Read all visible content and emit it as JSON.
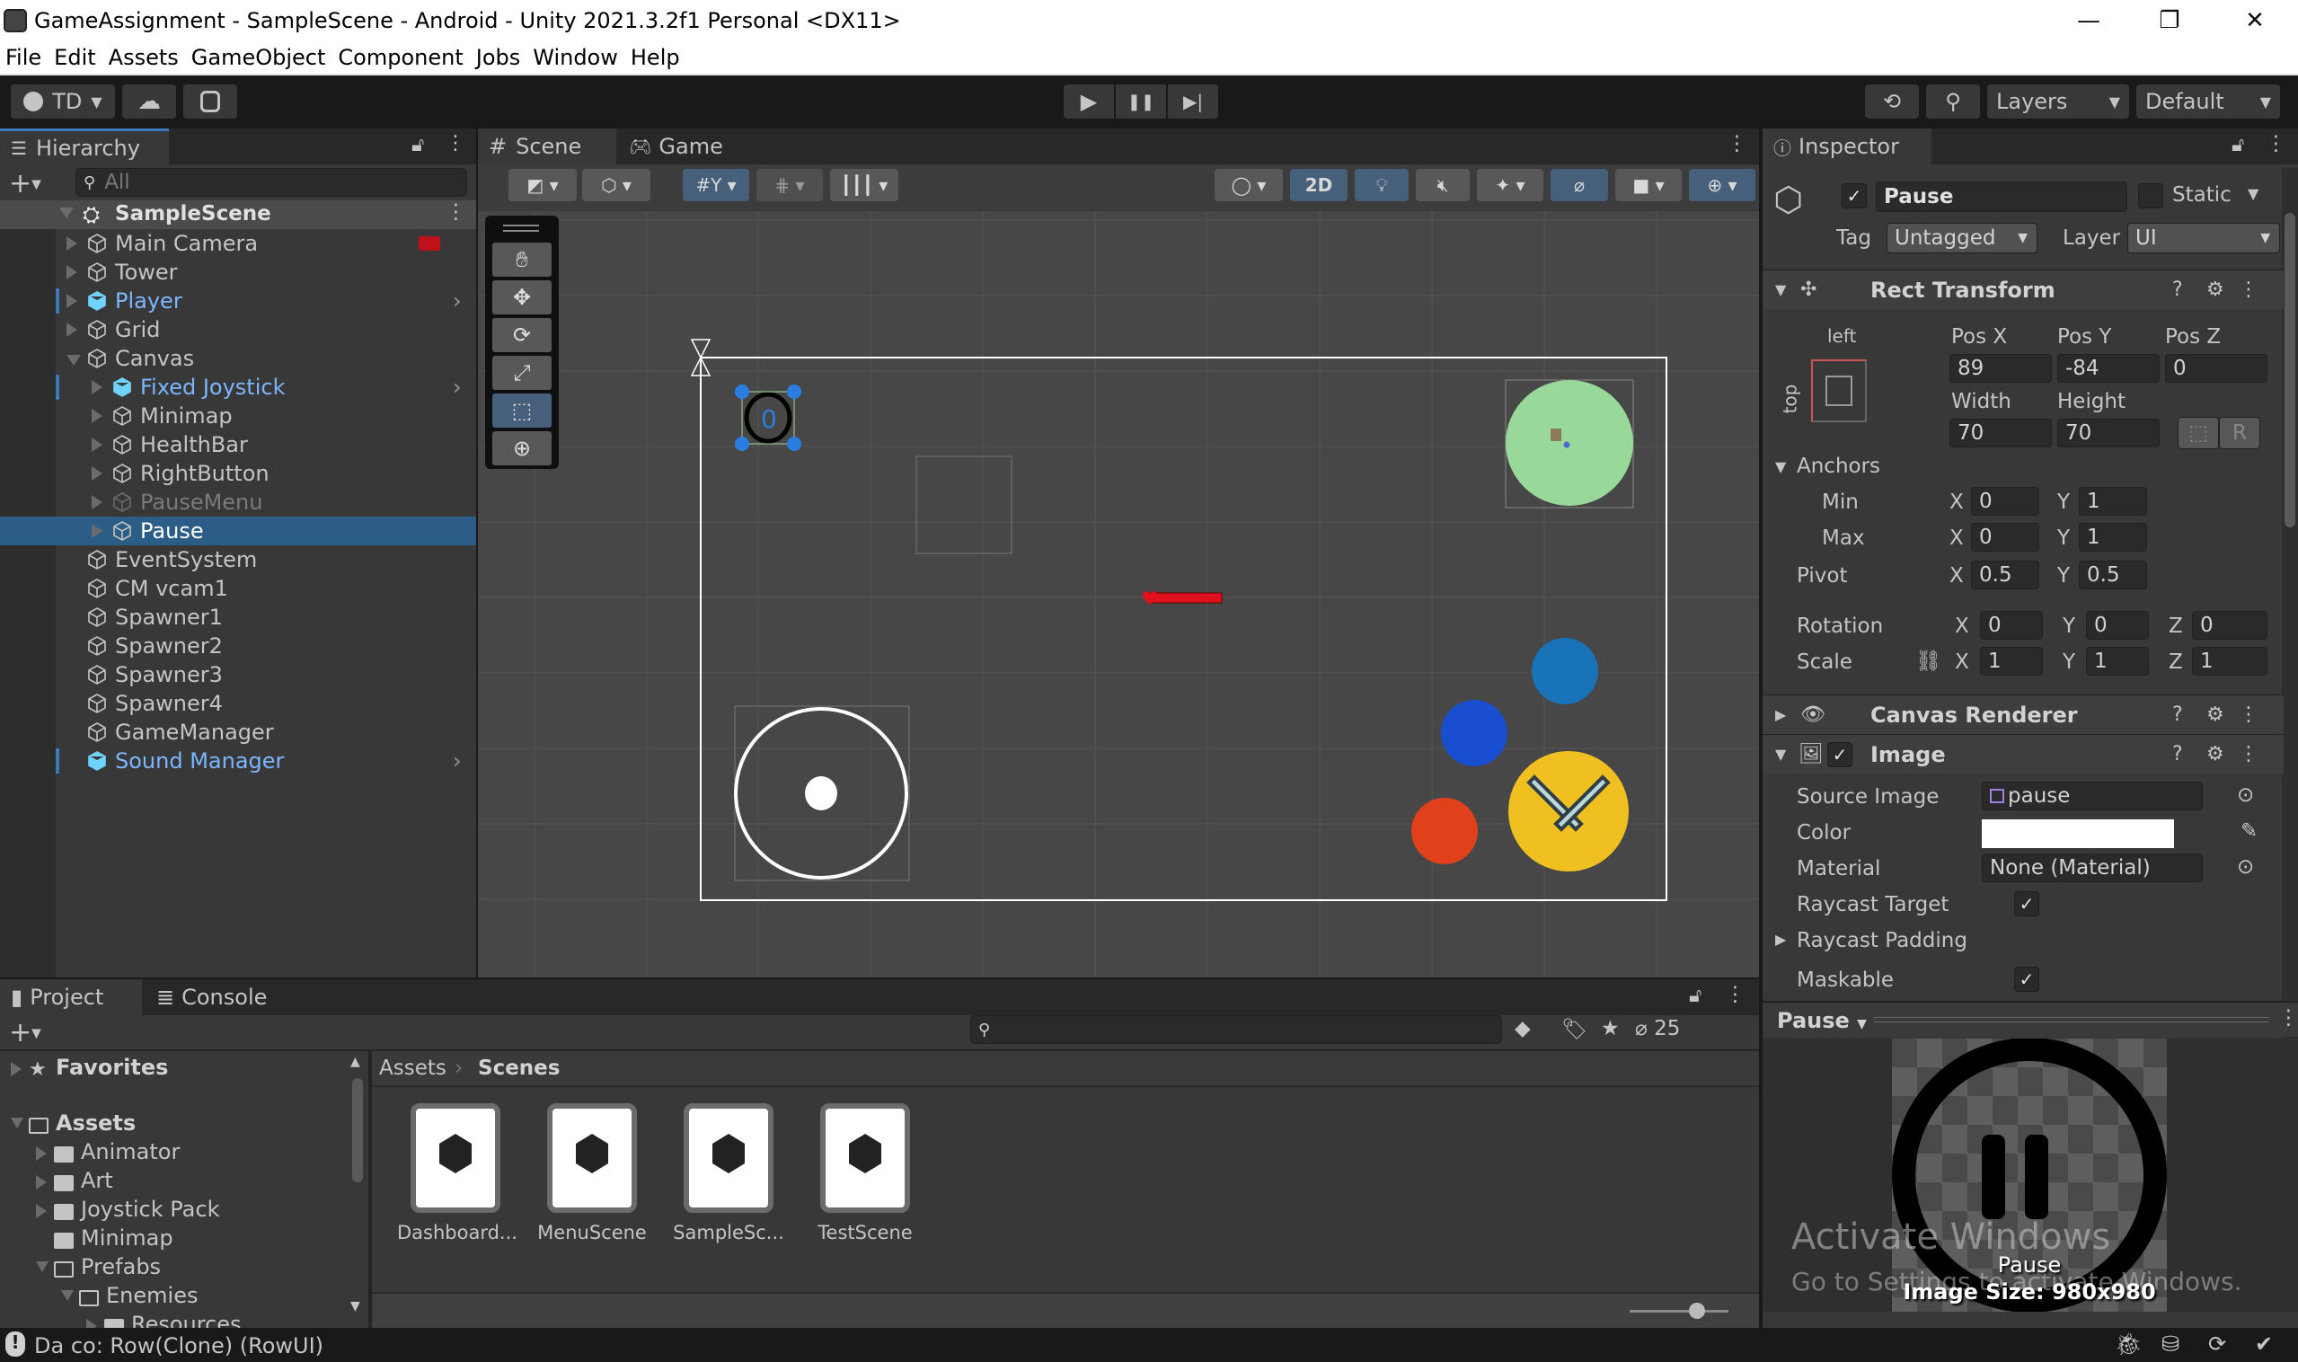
{
  "window": {
    "title": "GameAssignment - SampleScene - Android - Unity 2021.3.2f1 Personal <DX11>",
    "controls": {
      "minimize": "—",
      "restore": "❐",
      "close": "✕"
    }
  },
  "menu": [
    "File",
    "Edit",
    "Assets",
    "GameObject",
    "Component",
    "Jobs",
    "Window",
    "Help"
  ],
  "toolbar": {
    "account": "TD",
    "play_icon": "▶",
    "pause_icon": "❚❚",
    "step_icon": "▶|",
    "layers": "Layers",
    "layout": "Default"
  },
  "hierarchy": {
    "tab": "Hierarchy",
    "search_placeholder": "All",
    "scene": "SampleScene",
    "items": [
      {
        "label": "Main Camera",
        "depth": 1,
        "expand": "collapsed",
        "style": "normal"
      },
      {
        "label": "Tower",
        "depth": 1,
        "expand": "collapsed",
        "style": "normal"
      },
      {
        "label": "Player",
        "depth": 1,
        "expand": "collapsed",
        "style": "prefab"
      },
      {
        "label": "Grid",
        "depth": 1,
        "expand": "collapsed",
        "style": "normal"
      },
      {
        "label": "Canvas",
        "depth": 1,
        "expand": "expanded",
        "style": "normal"
      },
      {
        "label": "Fixed Joystick",
        "depth": 2,
        "expand": "collapsed",
        "style": "prefab"
      },
      {
        "label": "Minimap",
        "depth": 2,
        "expand": "collapsed",
        "style": "normal"
      },
      {
        "label": "HealthBar",
        "depth": 2,
        "expand": "collapsed",
        "style": "normal"
      },
      {
        "label": "RightButton",
        "depth": 2,
        "expand": "collapsed",
        "style": "normal"
      },
      {
        "label": "PauseMenu",
        "depth": 2,
        "expand": "collapsed",
        "style": "inactive"
      },
      {
        "label": "Pause",
        "depth": 2,
        "expand": "collapsed",
        "style": "selected"
      },
      {
        "label": "EventSystem",
        "depth": 1,
        "expand": "none",
        "style": "normal"
      },
      {
        "label": "CM vcam1",
        "depth": 1,
        "expand": "none",
        "style": "normal"
      },
      {
        "label": "Spawner1",
        "depth": 1,
        "expand": "none",
        "style": "normal"
      },
      {
        "label": "Spawner2",
        "depth": 1,
        "expand": "none",
        "style": "normal"
      },
      {
        "label": "Spawner3",
        "depth": 1,
        "expand": "none",
        "style": "normal"
      },
      {
        "label": "Spawner4",
        "depth": 1,
        "expand": "none",
        "style": "normal"
      },
      {
        "label": "GameManager",
        "depth": 1,
        "expand": "none",
        "style": "normal"
      },
      {
        "label": "Sound Manager",
        "depth": 1,
        "expand": "none",
        "style": "prefab"
      }
    ]
  },
  "scene_view": {
    "tabs": [
      "Scene",
      "Game"
    ],
    "active_tab": "Scene",
    "toggle_2d": "2D",
    "tools": [
      "hand",
      "move",
      "rotate",
      "scale",
      "rect",
      "transform"
    ],
    "active_tool": "rect"
  },
  "inspector": {
    "tab": "Inspector",
    "object_name": "Pause",
    "active": true,
    "static_label": "Static",
    "tag_label": "Tag",
    "tag": "Untagged",
    "layer_label": "Layer",
    "layer": "UI",
    "rect_transform": {
      "title": "Rect Transform",
      "anchor_h": "left",
      "anchor_v": "top",
      "pos_x_label": "Pos X",
      "pos_y_label": "Pos Y",
      "pos_z_label": "Pos Z",
      "pos_x": "89",
      "pos_y": "-84",
      "pos_z": "0",
      "width_label": "Width",
      "height_label": "Height",
      "width": "70",
      "height": "70",
      "raw_btn": "R",
      "anchors_label": "Anchors",
      "min_label": "Min",
      "max_label": "Max",
      "min_x": "0",
      "min_y": "1",
      "max_x": "0",
      "max_y": "1",
      "pivot_label": "Pivot",
      "pivot_x": "0.5",
      "pivot_y": "0.5",
      "rotation_label": "Rotation",
      "rot_x": "0",
      "rot_y": "0",
      "rot_z": "0",
      "scale_label": "Scale",
      "scale_x": "1",
      "scale_y": "1",
      "scale_z": "1"
    },
    "canvas_renderer": {
      "title": "Canvas Renderer"
    },
    "image": {
      "title": "Image",
      "enabled": true,
      "source_image_label": "Source Image",
      "source_image": "pause",
      "color_label": "Color",
      "color": "#ffffff",
      "material_label": "Material",
      "material": "None (Material)",
      "raycast_target_label": "Raycast Target",
      "raycast_target": true,
      "raycast_padding_label": "Raycast Padding",
      "maskable_label": "Maskable",
      "maskable": true
    },
    "preview": {
      "title": "Pause",
      "caption": "Pause",
      "size": "Image Size: 980x980"
    }
  },
  "project": {
    "tabs": [
      "Project",
      "Console"
    ],
    "active_tab": "Project",
    "hidden_count": "25",
    "breadcrumb": [
      "Assets",
      "Scenes"
    ],
    "tree": [
      {
        "label": "Favorites",
        "depth": 0,
        "expand": "collapsed",
        "icon": "star"
      },
      {
        "label": "Assets",
        "depth": 0,
        "expand": "expanded",
        "icon": "folder-open",
        "bold": true
      },
      {
        "label": "Animator",
        "depth": 1,
        "expand": "collapsed",
        "icon": "folder"
      },
      {
        "label": "Art",
        "depth": 1,
        "expand": "collapsed",
        "icon": "folder"
      },
      {
        "label": "Joystick Pack",
        "depth": 1,
        "expand": "collapsed",
        "icon": "folder"
      },
      {
        "label": "Minimap",
        "depth": 1,
        "expand": "none",
        "icon": "folder"
      },
      {
        "label": "Prefabs",
        "depth": 1,
        "expand": "expanded",
        "icon": "folder-open"
      },
      {
        "label": "Enemies",
        "depth": 2,
        "expand": "expanded",
        "icon": "folder-open"
      },
      {
        "label": "Resources",
        "depth": 3,
        "expand": "collapsed",
        "icon": "folder"
      }
    ],
    "assets": [
      "Dashboard...",
      "MenuScene",
      "SampleSc...",
      "TestScene"
    ]
  },
  "status": {
    "message": "Da co: Row(Clone) (RowUI)"
  },
  "watermark": {
    "line1": "Activate Windows",
    "line2": "Go to Settings to activate Windows."
  },
  "colors": {
    "accent": "#3a79bb",
    "selection": "#2c5d87",
    "prefab_text": "#7cb6ff",
    "minimap_green": "#98d898",
    "attack_yellow": "#f0c020",
    "health_red": "#e0101c"
  }
}
